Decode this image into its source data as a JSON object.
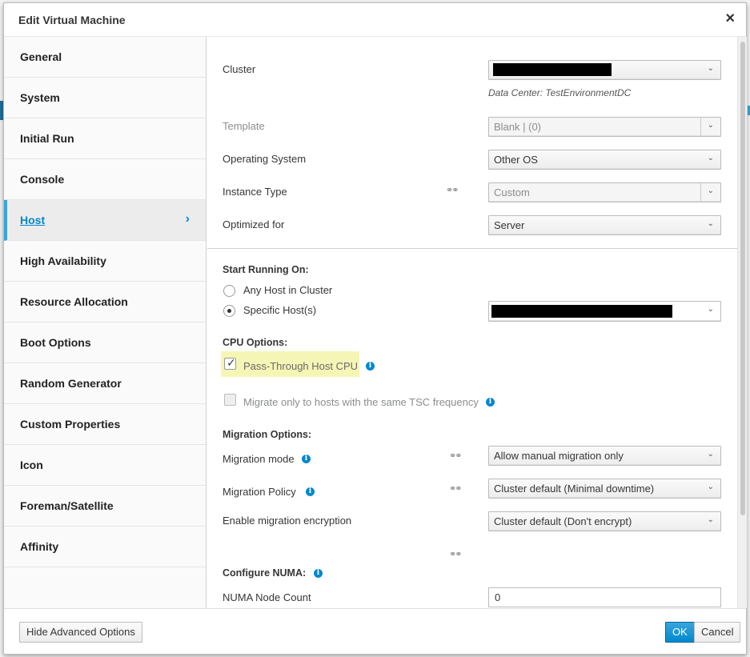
{
  "dialog": {
    "title": "Edit Virtual Machine",
    "close": "×"
  },
  "sidebar": {
    "items": [
      {
        "label": "General"
      },
      {
        "label": "System"
      },
      {
        "label": "Initial Run"
      },
      {
        "label": "Console"
      },
      {
        "label": "Host"
      },
      {
        "label": "High Availability"
      },
      {
        "label": "Resource Allocation"
      },
      {
        "label": "Boot Options"
      },
      {
        "label": "Random Generator"
      },
      {
        "label": "Custom Properties"
      },
      {
        "label": "Icon"
      },
      {
        "label": "Foreman/Satellite"
      },
      {
        "label": "Affinity"
      }
    ],
    "active": "Host",
    "active_chevron": "›"
  },
  "form": {
    "cluster_label": "Cluster",
    "data_center_note": "Data Center: TestEnvironmentDC",
    "template_label": "Template",
    "template_value": "Blank |  (0)",
    "os_label": "Operating System",
    "os_value": "Other OS",
    "instance_type_label": "Instance Type",
    "instance_type_value": "Custom",
    "optimized_label": "Optimized for",
    "optimized_value": "Server",
    "start_running_heading": "Start Running On:",
    "any_host_label": "Any Host in Cluster",
    "specific_host_label": "Specific Host(s)",
    "cpu_options_heading": "CPU Options:",
    "pass_through_label": "Pass-Through Host CPU",
    "pass_through_checked": true,
    "migrate_tsc_label": "Migrate only to hosts with the same TSC frequency",
    "migrate_tsc_checked": false,
    "migration_options_heading": "Migration Options:",
    "migration_mode_label": "Migration mode",
    "migration_mode_value": "Allow manual migration only",
    "migration_policy_label": "Migration Policy",
    "migration_policy_value": "Cluster default (Minimal downtime)",
    "migration_encryption_label": "Enable migration encryption",
    "migration_encryption_value": "Cluster default (Don't encrypt)",
    "numa_heading": "Configure NUMA:",
    "numa_node_count_label": "NUMA Node Count",
    "numa_node_count_value": "0"
  },
  "footer": {
    "hide_advanced": "Hide Advanced Options",
    "ok": "OK",
    "cancel": "Cancel"
  },
  "colors": {
    "accent": "#0088ce",
    "highlight": "#f5f6b5"
  }
}
